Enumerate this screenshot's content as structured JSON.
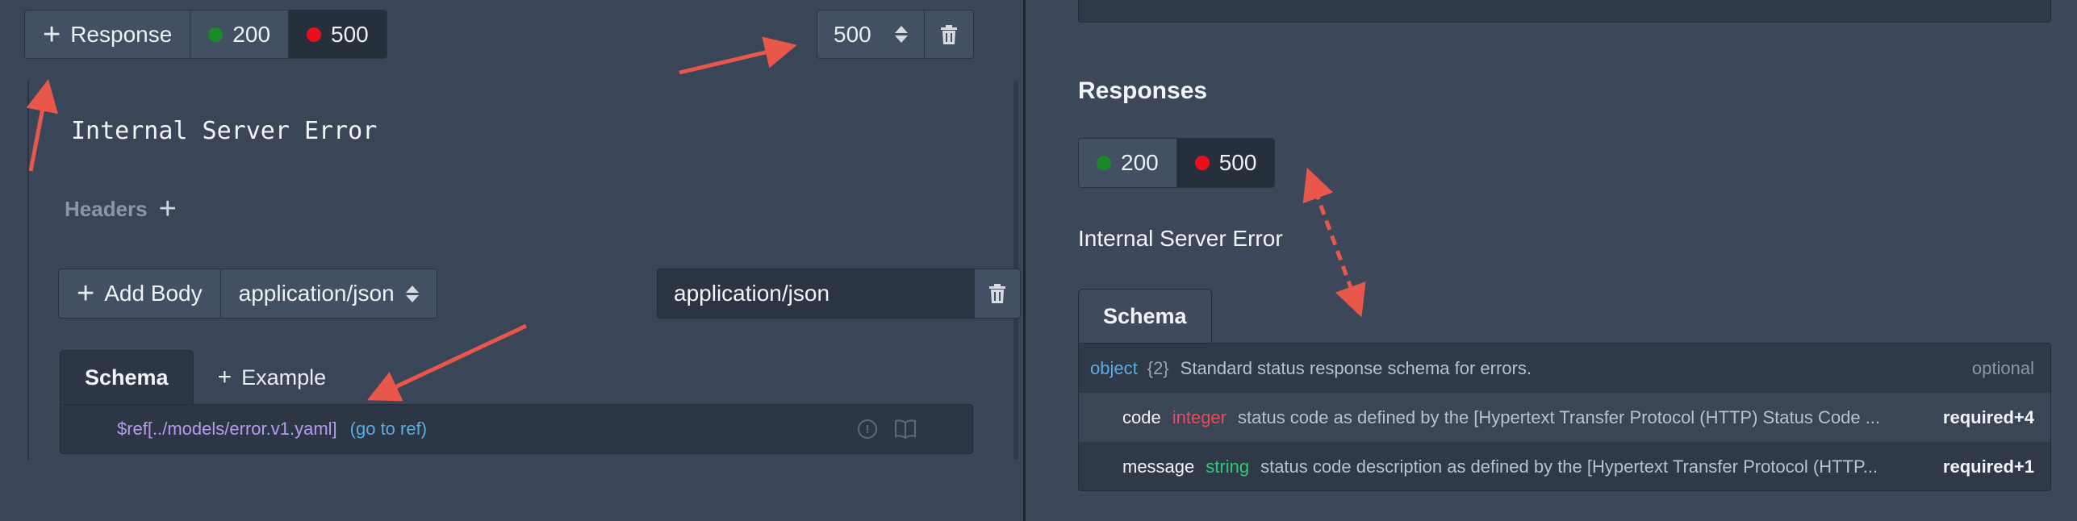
{
  "editor": {
    "add_response_label": "Response",
    "response_codes": [
      {
        "code": "200",
        "color": "#1a8a28"
      },
      {
        "code": "500",
        "color": "#e8101a"
      }
    ],
    "status_value": "500",
    "description": "Internal Server Error",
    "headers_label": "Headers",
    "add_body_label": "Add Body",
    "body_content_type": "application/json",
    "mime_value": "application/json",
    "tabs": {
      "schema": "Schema",
      "example": "Example"
    },
    "ref_text": "$ref[../models/error.v1.yaml]",
    "goto_ref": "(go to ref)"
  },
  "preview": {
    "title": "Responses",
    "response_codes": [
      {
        "code": "200",
        "color": "#1a8a28"
      },
      {
        "code": "500",
        "color": "#e8101a"
      }
    ],
    "description": "Internal Server Error",
    "schema_tab": "Schema",
    "rows": [
      {
        "type": "object",
        "count": "{2}",
        "desc": "Standard status response schema for errors.",
        "badge": "optional"
      },
      {
        "name": "code",
        "type": "integer",
        "desc": "status code as defined by the [Hypertext Transfer Protocol (HTTP) Status Code ...",
        "badge": "required+4"
      },
      {
        "name": "message",
        "type": "string",
        "desc": "status code description as defined by the [Hypertext Transfer Protocol (HTTP...",
        "badge": "required+1"
      }
    ]
  },
  "annotation_color": "#e8574a"
}
